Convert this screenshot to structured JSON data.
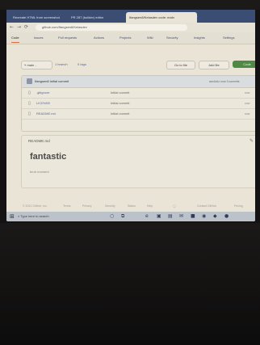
{
  "browser": {
    "tabs": [
      {
        "label": "Recreate HTML from screenshot"
      },
      {
        "label": "PR 287 (builder) editor"
      },
      {
        "label": "Ifangsen8/Kelasdev code: main",
        "active": true
      }
    ],
    "new_tab": "+",
    "url": "github.com/Ifangsen8/Kelasdev"
  },
  "repo_nav": {
    "tabs": [
      "Code",
      "Issues",
      "Pull requests",
      "Actions",
      "Projects",
      "Wiki",
      "Security",
      "Insights",
      "Settings"
    ],
    "selected": "Code"
  },
  "toolbar": {
    "branch": "main",
    "branches": "1 branch",
    "tags": "0 tags",
    "go_to_file": "Go to file",
    "add_file": "Add file",
    "code": "Code"
  },
  "commit": {
    "author_line": "Ifangsen8 Initial commit",
    "meta": "aec4a1c now  3 commits"
  },
  "files": [
    {
      "name": ".gitignore",
      "message": "Initial commit",
      "age": "now"
    },
    {
      "name": "LICENSE",
      "message": "Initial commit",
      "age": "now"
    },
    {
      "name": "README.md",
      "message": "Initial commit",
      "age": "now"
    }
  ],
  "readme": {
    "header": "README.md",
    "title": "fantastic",
    "body": "bruh moment"
  },
  "footer": {
    "items": [
      "© 2021 GitHub, Inc.",
      "Terms",
      "Privacy",
      "Security",
      "Status",
      "Help",
      "Contact GitHub",
      "Pricing"
    ]
  },
  "taskbar": {
    "search_placeholder": "Type here to search"
  }
}
